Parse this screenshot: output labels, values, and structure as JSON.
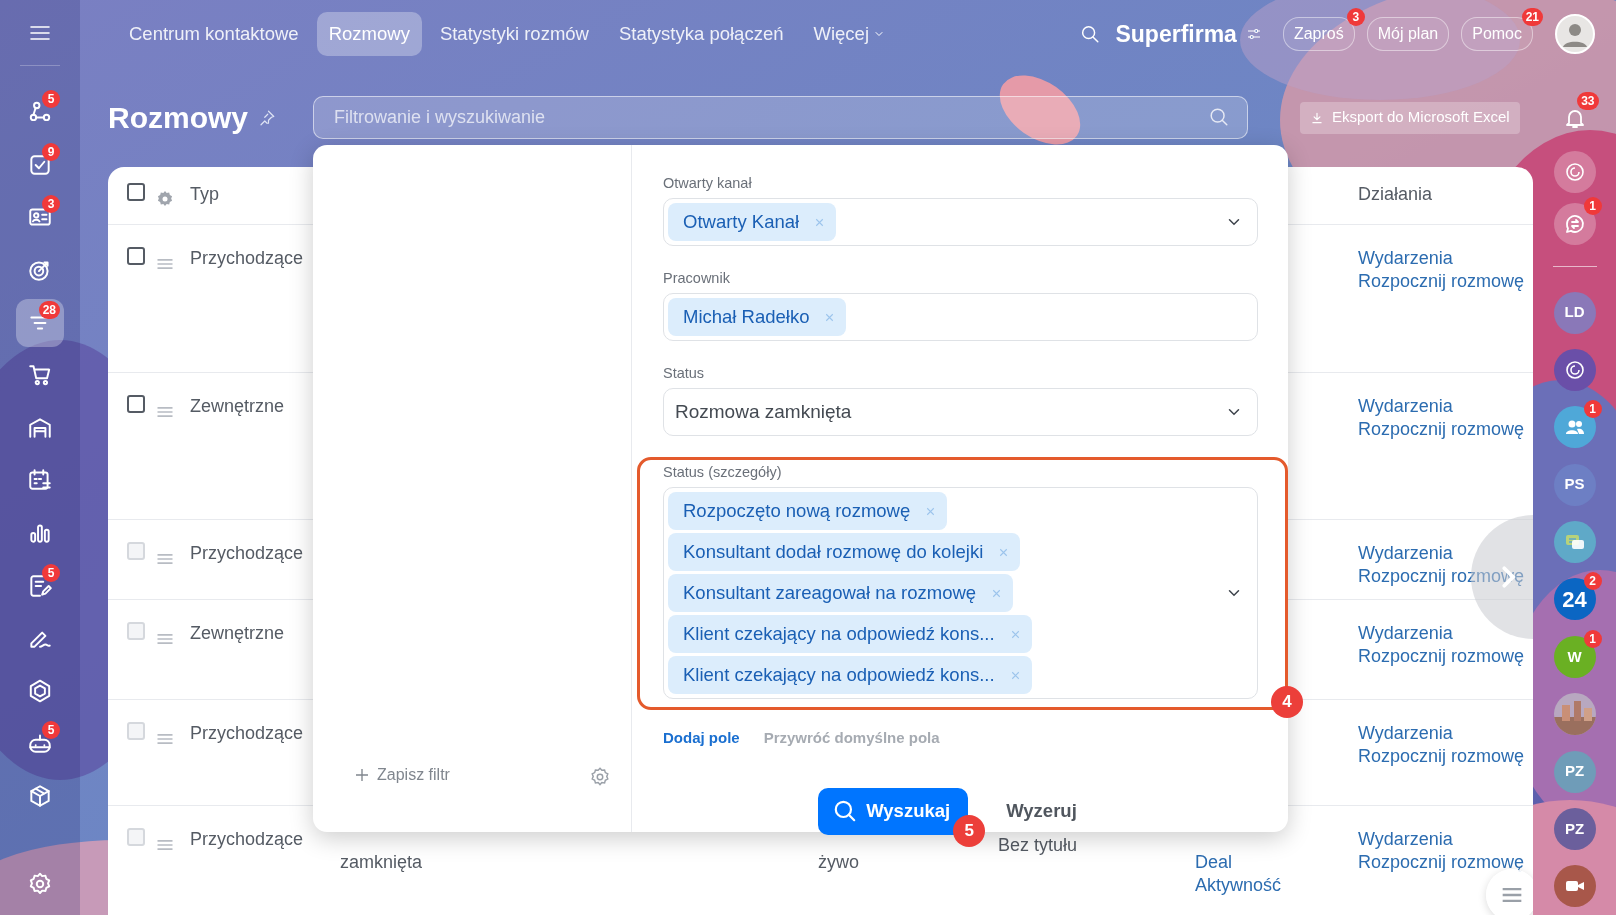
{
  "top_nav": {
    "items": [
      {
        "label": "Centrum kontaktowe",
        "selected": false,
        "has_menu": false
      },
      {
        "label": "Rozmowy",
        "selected": true,
        "has_menu": false
      },
      {
        "label": "Statystyki rozmów",
        "selected": false,
        "has_menu": false
      },
      {
        "label": "Statystyka połączeń",
        "selected": false,
        "has_menu": false
      },
      {
        "label": "Więcej",
        "selected": false,
        "has_menu": true
      }
    ]
  },
  "company": "Superfirma",
  "header_buttons": [
    {
      "label": "Zaproś",
      "badge": "3"
    },
    {
      "label": "Mój plan"
    },
    {
      "label": "Pomoc",
      "badge": "21"
    }
  ],
  "left_sidebar": {
    "items": [
      {
        "badge": "5",
        "selected": false
      },
      {
        "badge": "9",
        "selected": false
      },
      {
        "badge": "3",
        "selected": false
      },
      {
        "selected": false
      },
      {
        "badge": "28",
        "selected": true
      },
      {
        "selected": false
      },
      {
        "selected": false
      },
      {
        "selected": false
      },
      {
        "selected": false
      },
      {
        "badge": "5",
        "selected": false
      },
      {
        "selected": false
      },
      {
        "selected": false
      },
      {
        "badge": "5",
        "selected": false
      },
      {
        "selected": false
      }
    ]
  },
  "page": {
    "title": "Rozmowy",
    "search": {
      "placeholder": "Filtrowanie i wyszukiwanie"
    },
    "export_button": "Eksport do Microsoft Excel"
  },
  "notifications_badge": "33",
  "right_sidebar": {
    "items": [
      {
        "kind": "icon"
      },
      {
        "kind": "icon",
        "badge": "1"
      },
      {
        "kind": "divider"
      },
      {
        "kind": "avatar",
        "initials": "LD",
        "color": "#8a78b8"
      },
      {
        "kind": "icon",
        "color": "#6a4fa8"
      },
      {
        "kind": "icon",
        "badge": "1",
        "color": "#4fa8d8"
      },
      {
        "kind": "avatar",
        "initials": "PS",
        "color": "#6d7fc4"
      },
      {
        "kind": "icon",
        "color": "#5fa9c8"
      },
      {
        "kind": "avatar",
        "initials": "24",
        "badge": "2",
        "color": "#0b66c3"
      },
      {
        "kind": "avatar",
        "initials": "W",
        "badge": "1",
        "color": "#6ab023"
      },
      {
        "kind": "picture"
      },
      {
        "kind": "avatar",
        "initials": "PZ",
        "color": "#6f9cb8"
      },
      {
        "kind": "avatar",
        "initials": "PZ",
        "color": "#6b5f9c"
      },
      {
        "kind": "icon",
        "color": "#a8574a"
      }
    ]
  },
  "table": {
    "columns": [
      "Typ",
      "Działania"
    ],
    "select_all": {
      "checked": false
    },
    "rows": [
      {
        "type": "Przychodzące",
        "disabled": false,
        "actions": [
          "Wydarzenia",
          "Rozpocznij rozmowę"
        ]
      },
      {
        "type": "Zewnętrzne",
        "disabled": false,
        "actions": [
          "Wydarzenia",
          "Rozpocznij rozmowę"
        ]
      },
      {
        "type": "Przychodzące",
        "disabled": true,
        "actions": [
          "Wydarzenia",
          "Rozpocznij rozmowę"
        ]
      },
      {
        "type": "Zewnętrzne",
        "disabled": true,
        "actions": [
          "Wydarzenia",
          "Rozpocznij rozmowę"
        ]
      },
      {
        "type": "Przychodzące",
        "disabled": true,
        "actions": [
          "Wydarzenia",
          "Rozpocznij rozmowę"
        ]
      },
      {
        "type": "Przychodzące",
        "disabled": true,
        "actions": [
          "Wydarzenia",
          "Rozpocznij rozmowę"
        ],
        "column_2": [
          "zamknięta"
        ],
        "column_5": [
          "żywo"
        ],
        "column_6": [
          "Bez tytułu"
        ],
        "column_7": [
          "Deal",
          "Aktywność"
        ]
      }
    ]
  },
  "filter_popup": {
    "save_filter": "Zapisz filtr",
    "fields": [
      {
        "label": "Otwarty kanał",
        "kind": "tags",
        "tags": [
          "Otwarty Kanał"
        ],
        "dropdown": true,
        "highlighted": false
      },
      {
        "label": "Pracownik",
        "kind": "tags",
        "tags": [
          "Michał Radełko"
        ],
        "dropdown": false,
        "highlighted": false
      },
      {
        "label": "Status",
        "kind": "select",
        "value": "Rozmowa zamknięta",
        "dropdown": true,
        "highlighted": false
      },
      {
        "label": "Status (szczegóły)",
        "kind": "tags",
        "tags": [
          "Rozpoczęto nową rozmowę",
          "Konsultant dodał rozmowę do kolejki",
          "Konsultant zareagował na rozmowę",
          "Klient czekający na odpowiedź kons...",
          "Klient czekający na odpowiedź kons..."
        ],
        "dropdown": true,
        "highlighted": true,
        "step": "4"
      }
    ],
    "add_field": "Dodaj pole",
    "restore_fields": "Przywróć domyślne pola",
    "search_button": {
      "label": "Wyszukaj",
      "step": "5"
    },
    "reset_button": "Wyzeruj"
  }
}
